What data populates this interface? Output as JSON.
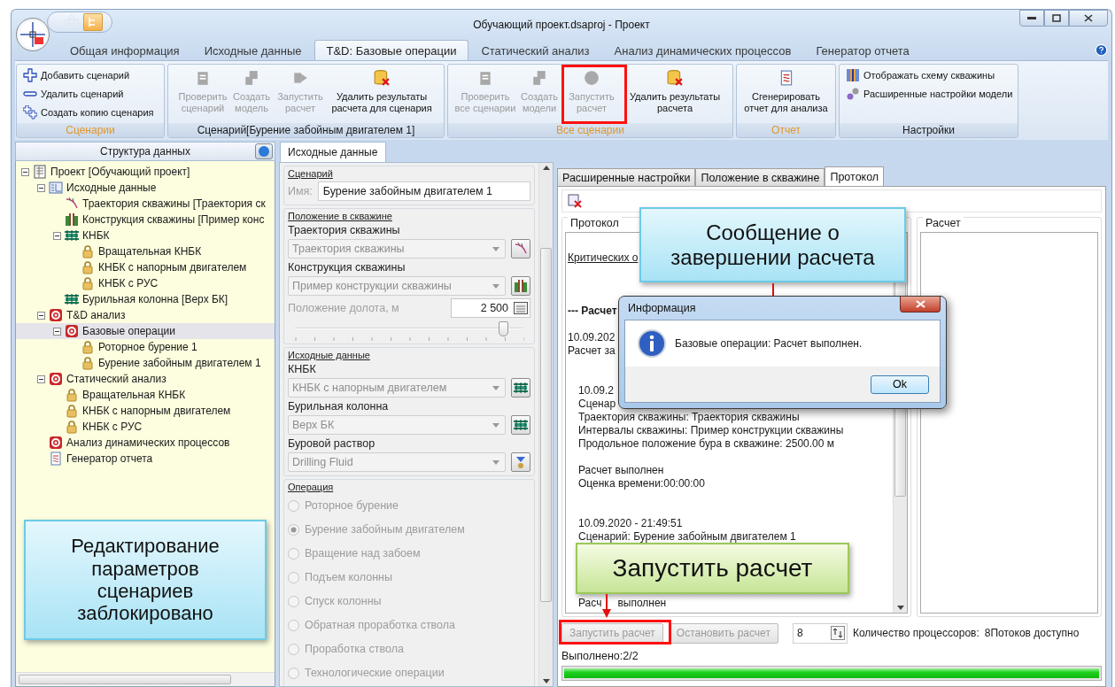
{
  "window": {
    "title": "Обучающий проект.dsaproj - Проект"
  },
  "ribbon": {
    "tabs": [
      {
        "label": "Общая информация",
        "selected": false
      },
      {
        "label": "Исходные данные",
        "selected": false
      },
      {
        "label": "T&D: Базовые операции",
        "selected": true
      },
      {
        "label": "Статический анализ",
        "selected": false
      },
      {
        "label": "Анализ динамических процессов",
        "selected": false
      },
      {
        "label": "Генератор отчета",
        "selected": false
      }
    ],
    "groups": [
      {
        "caption": "Сценарии",
        "accent": true,
        "kind": "list",
        "buttons": [
          {
            "label": "Добавить сценарий",
            "disabled": false
          },
          {
            "label": "Удалить сценарий",
            "disabled": false
          },
          {
            "label": "Создать копию сценария",
            "disabled": false
          }
        ]
      },
      {
        "caption": "Сценарий[Бурение забойным двигателем 1]",
        "accent": false,
        "kind": "large",
        "buttons": [
          {
            "label": "Проверить\nсценарий",
            "disabled": true
          },
          {
            "label": "Создать\nмодель",
            "disabled": true
          },
          {
            "label": "Запустить\nрасчет",
            "disabled": true
          },
          {
            "label": "Удалить результаты\nрасчета для сценария",
            "disabled": false
          }
        ]
      },
      {
        "caption": "Все сценарии",
        "accent": true,
        "kind": "large",
        "buttons": [
          {
            "label": "Проверить\nвсе сценарии",
            "disabled": true
          },
          {
            "label": "Создать\nмодели",
            "disabled": true
          },
          {
            "label": "Запустить\nрасчет",
            "disabled": true
          },
          {
            "label": "Удалить результаты\nрасчета",
            "disabled": false
          }
        ]
      },
      {
        "caption": "Отчет",
        "accent": true,
        "kind": "large",
        "buttons": [
          {
            "label": "Сгенерировать\nотчет для анализа",
            "disabled": false
          }
        ]
      },
      {
        "caption": "Настройки",
        "accent": false,
        "kind": "list",
        "buttons": [
          {
            "label": "Отображать схему скважины",
            "disabled": false
          },
          {
            "label": "Расширенные настройки модели",
            "disabled": false
          }
        ]
      }
    ]
  },
  "tree": {
    "header": "Структура данных",
    "items": [
      {
        "label": "Проект [Обучающий проект]",
        "kind": "project",
        "expanded": true,
        "selected": false,
        "children": [
          {
            "label": "Исходные данные",
            "kind": "folder",
            "expanded": true,
            "selected": false,
            "children": [
              {
                "label": "Траектория скважины [Траектория ск",
                "kind": "trajectory",
                "selected": false
              },
              {
                "label": "Конструкция скважины [Пример конс",
                "kind": "construction",
                "selected": false
              },
              {
                "label": "КНБК",
                "kind": "assembly",
                "expanded": true,
                "selected": false,
                "children": [
                  {
                    "label": "Вращательная КНБК",
                    "kind": "scenario",
                    "selected": false
                  },
                  {
                    "label": "КНБК с напорным двигателем",
                    "kind": "scenario",
                    "selected": false
                  },
                  {
                    "label": "КНБК с РУС",
                    "kind": "scenario",
                    "selected": false
                  }
                ]
              },
              {
                "label": "Бурильная колонна [Верх БК]",
                "kind": "assembly",
                "selected": false
              }
            ]
          },
          {
            "label": "T&D анализ",
            "kind": "analysis",
            "expanded": true,
            "selected": false,
            "children": [
              {
                "label": "Базовые операции",
                "kind": "analysis",
                "expanded": true,
                "selected": true,
                "children": [
                  {
                    "label": "Роторное бурение 1",
                    "kind": "scenario",
                    "selected": false
                  },
                  {
                    "label": "Бурение забойным двигателем 1",
                    "kind": "scenario",
                    "selected": false
                  }
                ]
              }
            ]
          },
          {
            "label": "Статический анализ",
            "kind": "analysis",
            "expanded": true,
            "selected": false,
            "children": [
              {
                "label": "Вращательная КНБК",
                "kind": "scenario",
                "selected": false
              },
              {
                "label": "КНБК с напорным двигателем",
                "kind": "scenario",
                "selected": false
              },
              {
                "label": "КНБК с РУС",
                "kind": "scenario",
                "selected": false
              }
            ]
          },
          {
            "label": "Анализ динамических процессов",
            "kind": "analysis",
            "selected": false
          },
          {
            "label": "Генератор отчета",
            "kind": "report",
            "selected": false
          }
        ]
      }
    ]
  },
  "editor": {
    "tab": "Исходные данные",
    "scenario": {
      "legend": "Сценарий",
      "name_label": "Имя:",
      "name_value": "Бурение забойным двигателем 1"
    },
    "position": {
      "legend": "Положение в скважине",
      "fields": [
        {
          "label": "Траектория скважины",
          "value": "Траектория скважины",
          "disabled": true
        },
        {
          "label": "Конструкция скважины",
          "value": "Пример конструкции скважины",
          "disabled": true
        }
      ],
      "bit_label": "Положение долота, м",
      "bit_value": "2 500",
      "level": 0.91
    },
    "inputs": {
      "legend": "Исходные данные",
      "fields": [
        {
          "label": "КНБК",
          "value": "КНБК с напорным двигателем",
          "disabled": true
        },
        {
          "label": "Бурильная колонна",
          "value": "Верх БК",
          "disabled": true
        },
        {
          "label": "Буровой раствор",
          "value": "Drilling Fluid",
          "disabled": true
        }
      ]
    },
    "operation": {
      "legend": "Операция",
      "options": [
        {
          "label": "Роторное бурение",
          "selected": false,
          "disabled": true
        },
        {
          "label": "Бурение забойным двигателем",
          "selected": true,
          "disabled": true
        },
        {
          "label": "Вращение над забоем",
          "selected": false,
          "disabled": true
        },
        {
          "label": "Подъем колонны",
          "selected": false,
          "disabled": true
        },
        {
          "label": "Спуск колонны",
          "selected": false,
          "disabled": true
        },
        {
          "label": "Обратная проработка ствола",
          "selected": false,
          "disabled": true
        },
        {
          "label": "Проработка ствола",
          "selected": false,
          "disabled": true
        },
        {
          "label": "Технологические операции",
          "selected": false,
          "disabled": true
        }
      ]
    }
  },
  "details": {
    "tabs": [
      {
        "label": "Расширенные настройки",
        "selected": false
      },
      {
        "label": "Положение в скважине",
        "selected": false
      },
      {
        "label": "Протокол",
        "selected": true
      }
    ],
    "protocol": {
      "legend": "Протокол",
      "lines": [
        {
          "kind": "link",
          "text": "Критических о"
        },
        {
          "kind": "blank"
        },
        {
          "kind": "blank"
        },
        {
          "kind": "blank"
        },
        {
          "kind": "bold",
          "text": "--- Расчет"
        },
        {
          "kind": "blank"
        },
        {
          "kind": "text",
          "text": "10.09.202"
        },
        {
          "kind": "text",
          "text": "Расчет за"
        },
        {
          "kind": "blank"
        },
        {
          "kind": "blank"
        },
        {
          "kind": "indent",
          "text": "10.09.2"
        },
        {
          "kind": "indent",
          "text": "Сценар"
        },
        {
          "kind": "indent",
          "text": "Траектория скважины: Траектория скважины"
        },
        {
          "kind": "indent",
          "text": "Интервалы скважины: Пример конструкции скважины"
        },
        {
          "kind": "indent",
          "text": "Продольное положение бура в скважине: 2500.00 м"
        },
        {
          "kind": "blank"
        },
        {
          "kind": "indent",
          "text": "Расчет выполнен"
        },
        {
          "kind": "indent",
          "text": "Оценка времени:00:00:00"
        },
        {
          "kind": "blank"
        },
        {
          "kind": "blank"
        },
        {
          "kind": "indent",
          "text": "10.09.2020 - 21:49:51"
        },
        {
          "kind": "indent",
          "text": "Сценарий: Бурение забойным двигателем 1"
        },
        {
          "kind": "blank"
        },
        {
          "kind": "blank"
        },
        {
          "kind": "blank"
        },
        {
          "kind": "blank"
        },
        {
          "kind": "split",
          "parts": [
            "Расч",
            "выполнен"
          ]
        }
      ]
    },
    "result": {
      "legend": "Расчет"
    },
    "run_button": {
      "label": "Запустить расчет",
      "disabled": true
    },
    "stop_button": {
      "label": "Остановить расчет",
      "disabled": true
    },
    "threads_value": "8",
    "threads_label": "Количество процессоров:",
    "threads_info": "8Потоков доступно",
    "progress_label": "Выполнено:2/2",
    "progress": {
      "level": 1
    }
  },
  "callouts": [
    {
      "kind": "info",
      "text": "Редактирование параметров сценариев заблокировано"
    },
    {
      "kind": "info",
      "text": "Сообщение о завершении расчета"
    },
    {
      "kind": "action",
      "text": "Запустить расчет"
    }
  ],
  "dialog": {
    "title": "Информация",
    "message": "Базовые операции: Расчет выполнен.",
    "ok": "Ok"
  }
}
